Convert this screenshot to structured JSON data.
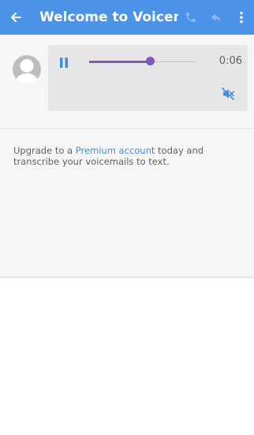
{
  "header": {
    "title": "Welcome to Voicem...",
    "icons": [
      "back-arrow-icon",
      "phone-icon",
      "reply-icon",
      "more-vertical-icon"
    ],
    "bar_color": "#4a93e8"
  },
  "player": {
    "time": "0:06",
    "progress_fraction": 0.58,
    "state": "playing",
    "accent_color": "#7e57c2",
    "icons": [
      "pause-icon",
      "speaker-muted-icon"
    ]
  },
  "upgrade": {
    "prefix": "Upgrade to a ",
    "link_text": "Premium account",
    "suffix": " today and transcribe your voicemails to text."
  }
}
